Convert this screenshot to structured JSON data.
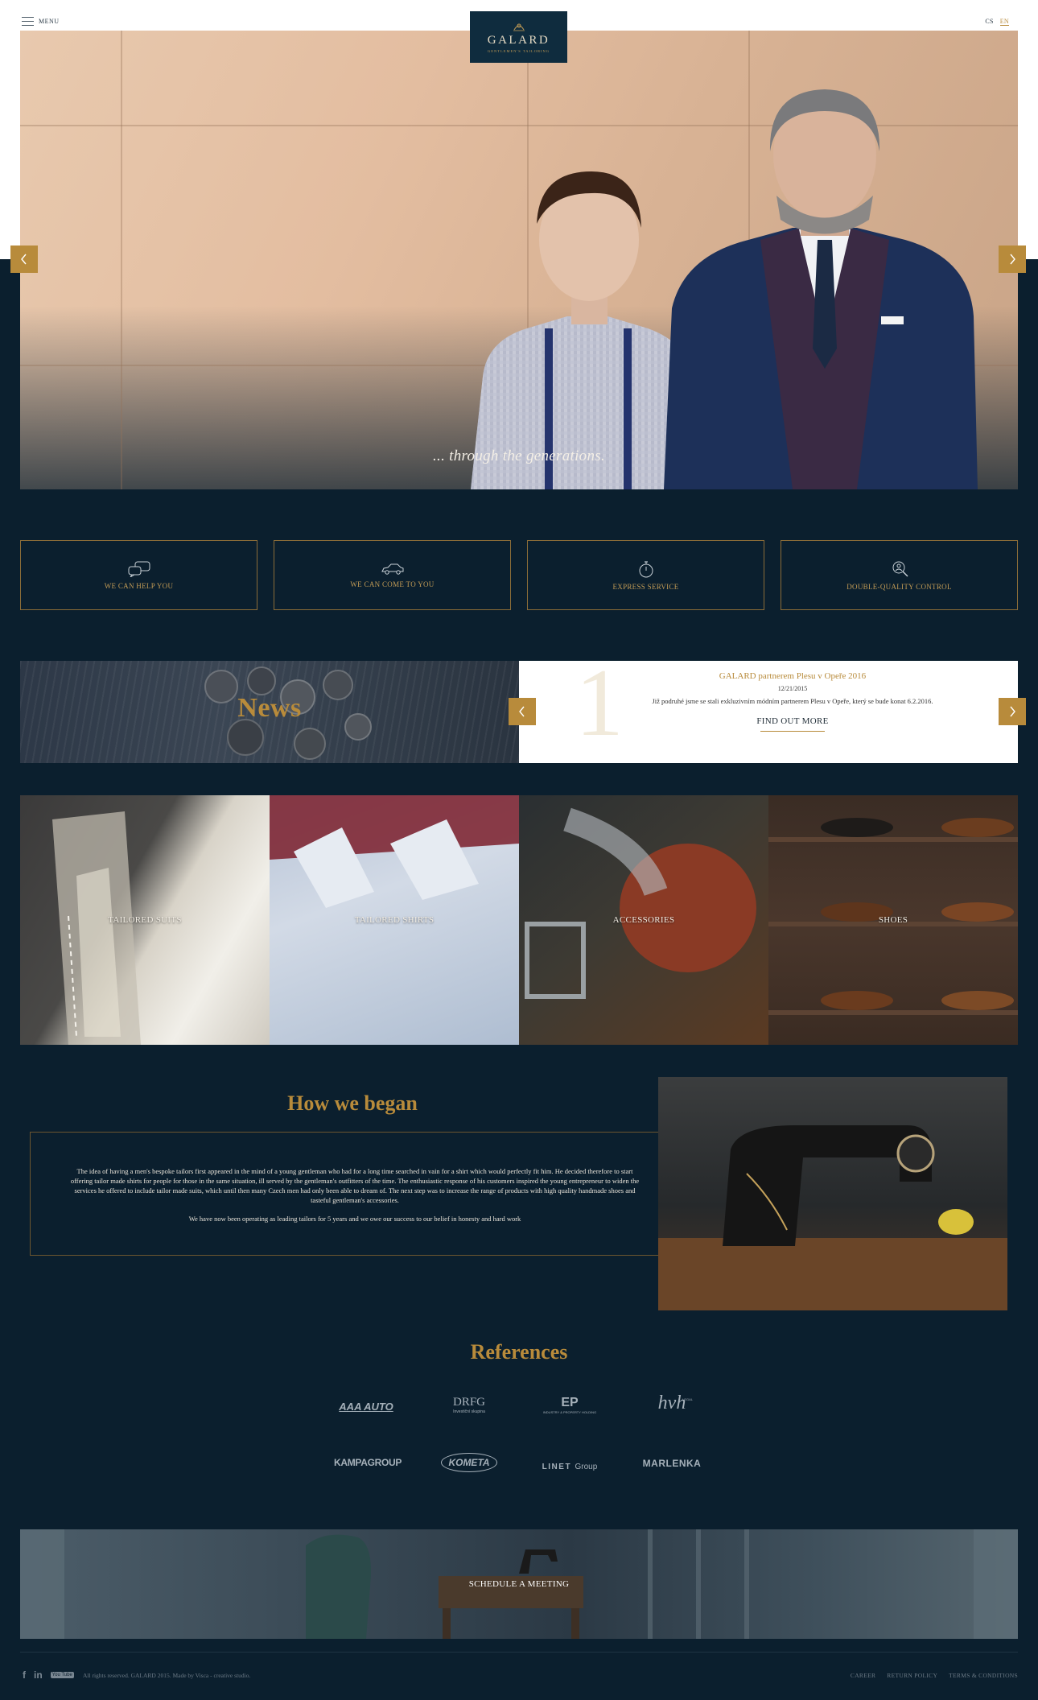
{
  "header": {
    "menu_label": "MENU",
    "logo": {
      "wordmark": "GALARD",
      "tagline": "GENTLEMEN'S TAILORING"
    },
    "languages": [
      {
        "code": "CS",
        "active": false
      },
      {
        "code": "EN",
        "active": true
      }
    ]
  },
  "hero": {
    "caption": "... through the generations."
  },
  "services": [
    {
      "label": "WE CAN HELP YOU",
      "icon": "chat-bubbles-icon"
    },
    {
      "label": "WE CAN COME TO YOU",
      "icon": "car-icon"
    },
    {
      "label": "EXPRESS SERVICE",
      "icon": "stopwatch-icon"
    },
    {
      "label": "DOUBLE-QUALITY CONTROL",
      "icon": "magnifier-person-icon"
    }
  ],
  "news": {
    "title": "News",
    "item": {
      "number": "1",
      "headline": "GALARD partnerem Plesu v Opeře 2016",
      "date": "12/21/2015",
      "text": "Již podruhé jsme se stali exkluzivním módním partnerem Plesu v Opeře, který se bude konat 6.2.2016.",
      "link": "FIND OUT MORE"
    }
  },
  "categories": [
    {
      "label": "TAILORED SUITS"
    },
    {
      "label": "TAILORED SHIRTS"
    },
    {
      "label": "ACCESSORIES"
    },
    {
      "label": "SHOES"
    }
  ],
  "about": {
    "title": "How we began",
    "paragraph1": "The idea of having a men's bespoke tailors first appeared in the mind of a young gentleman who had for a long time searched in vain for a shirt which would perfectly fit him. He decided therefore to start offering tailor made shirts for people for those in the same situation, ill served by the gentleman's outfitters of the time. The enthusiastic response of his customers inspired the young entrepreneur to widen the services he offered to include tailor made suits, which until then many Czech men had only been able to dream of. The next step was to increase the range of products with high quality handmade shoes and tasteful gentleman's accessories.",
    "paragraph2": "We have now been operating as leading tailors for 5 years and we owe our success to our belief in honesty and hard work"
  },
  "references": {
    "title": "References",
    "logos": [
      {
        "name": "AAA AUTO",
        "sub": ""
      },
      {
        "name": "DRFG",
        "sub": "Investiční skupina"
      },
      {
        "name": "EP",
        "sub": "INDUSTRY & PROPERTY HOLDING"
      },
      {
        "name": "hvh",
        "sub": "LEGAL"
      },
      {
        "name": "KAMPAGROUP",
        "sub": ""
      },
      {
        "name": "KOMETA",
        "sub": ""
      },
      {
        "name": "LINET",
        "sub": "Group"
      },
      {
        "name": "MARLENKA",
        "sub": ""
      }
    ]
  },
  "meeting": {
    "button": "SCHEDULE A MEETING"
  },
  "footer": {
    "social": [
      "f",
      "in",
      "You Tube"
    ],
    "copyright": "All rights reserved. GALARD 2015. Made by Visca - creative studio.",
    "links": [
      "CAREER",
      "RETURN POLICY",
      "TERMS & CONDITIONS"
    ]
  },
  "colors": {
    "navy": "#0b1f2e",
    "gold": "#b88b3b",
    "logo_bg": "#0f2c3e"
  }
}
